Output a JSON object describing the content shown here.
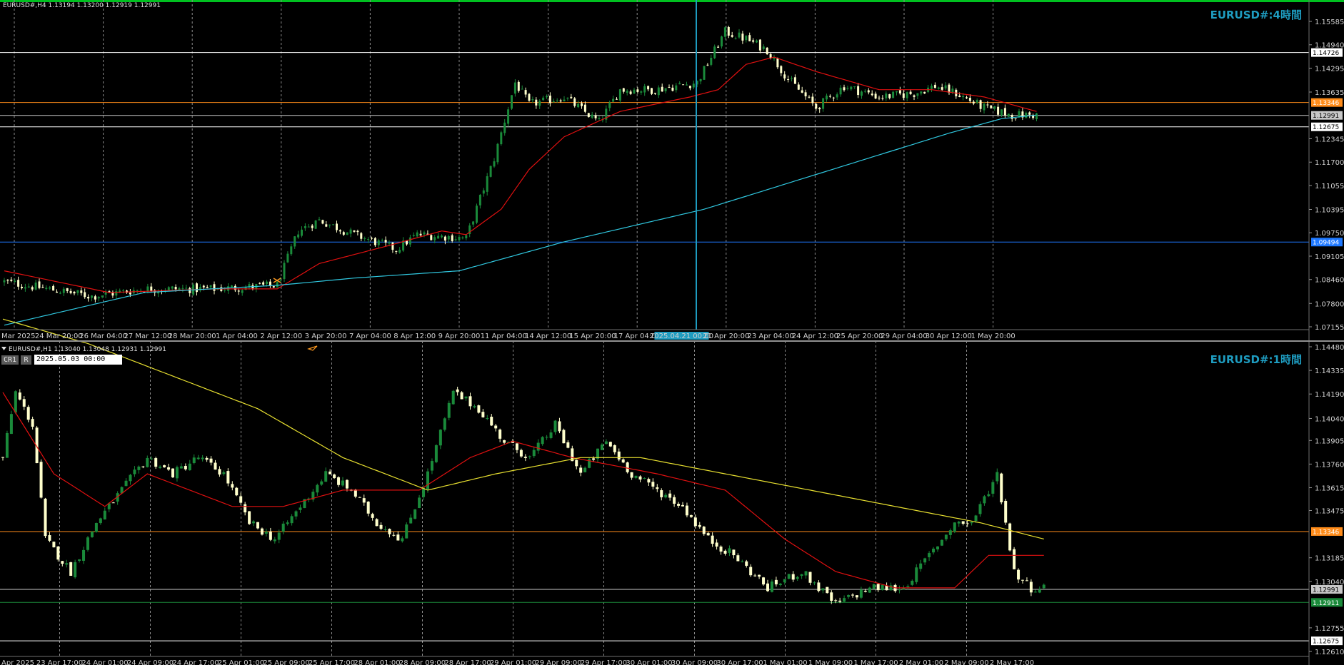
{
  "top_panel": {
    "header": "EURUSD#,H4  1.13194 1.13200 1.12919 1.12991",
    "title": "EURUSD#:4時間",
    "selected_time": "2025.04.21 00:00"
  },
  "bottom_panel": {
    "header": "EURUSD#,H1  1.13040 1.13048 1.12931 1.12991",
    "title": "EURUSD#:1時間",
    "buttons": {
      "cr1": "CR1",
      "r": "R"
    },
    "date_input": "2025.05.03  00:00"
  },
  "colors": {
    "bull": "#1a8a3a",
    "bear": "#ffffcc",
    "ma_fast": "#e01010",
    "ma_slow_top": "#30c8e0",
    "ma_slow_bottom": "#e8e030",
    "accent_top": "#00c020",
    "title": "#1e9cc0"
  },
  "chart_data": [
    {
      "type": "candlestick",
      "title": "EURUSD#:4時間",
      "ylim": [
        1.07155,
        1.15585
      ],
      "y_ticks": [
        "1.15585",
        "1.14940",
        "1.14295",
        "1.13635",
        "1.12345",
        "1.11700",
        "1.11055",
        "1.10395",
        "1.09750",
        "1.09105",
        "1.08460",
        "1.07800",
        "1.07155"
      ],
      "x_ticks": [
        "Mar 2025",
        "24 Mar 20:00",
        "26 Mar 04:00",
        "27 Mar 12:00",
        "28 Mar 20:00",
        "1 Apr 04:00",
        "2 Apr 12:00",
        "3 Apr 20:00",
        "7 Apr 04:00",
        "8 Apr 12:00",
        "9 Apr 20:00",
        "11 Apr 04:00",
        "14 Apr 12:00",
        "15 Apr 20:00",
        "17 Apr 04:00",
        "2025.04.21 00:00",
        "21 Apr 20:00",
        "23 Apr 04:00",
        "24 Apr 12:00",
        "25 Apr 20:00",
        "29 Apr 04:00",
        "30 Apr 12:00",
        "1 May 20:00"
      ],
      "price_lines": [
        {
          "value": 1.14726,
          "label": "1.14726",
          "color": "#ffffff"
        },
        {
          "value": 1.13346,
          "label": "1.13346",
          "color": "#ff8c1a"
        },
        {
          "value": 1.12991,
          "label": "1.12991",
          "color": "#c8c8c8"
        },
        {
          "value": 1.12675,
          "label": "1.12675",
          "color": "#ffffff"
        },
        {
          "value": 1.09494,
          "label": "1.09494",
          "color": "#1e78ff"
        }
      ],
      "close_anchors": [
        [
          0,
          1.084
        ],
        [
          25,
          1.08
        ],
        [
          40,
          1.082
        ],
        [
          60,
          1.082
        ],
        [
          78,
          1.083
        ],
        [
          84,
          1.098
        ],
        [
          90,
          1.101
        ],
        [
          100,
          1.097
        ],
        [
          112,
          1.093
        ],
        [
          118,
          1.097
        ],
        [
          132,
          1.096
        ],
        [
          140,
          1.118
        ],
        [
          146,
          1.139
        ],
        [
          150,
          1.133
        ],
        [
          160,
          1.135
        ],
        [
          170,
          1.128
        ],
        [
          176,
          1.137
        ],
        [
          186,
          1.137
        ],
        [
          198,
          1.139
        ],
        [
          206,
          1.153
        ],
        [
          212,
          1.151
        ],
        [
          218,
          1.148
        ],
        [
          224,
          1.14
        ],
        [
          232,
          1.132
        ],
        [
          240,
          1.138
        ],
        [
          250,
          1.135
        ],
        [
          260,
          1.136
        ],
        [
          266,
          1.138
        ],
        [
          272,
          1.136
        ],
        [
          280,
          1.132
        ],
        [
          288,
          1.13
        ],
        [
          295,
          1.13
        ]
      ],
      "series": [
        {
          "name": "",
          "color": "#e01010",
          "values": [
            [
              0,
              1.087
            ],
            [
              30,
              1.081
            ],
            [
              60,
              1.082
            ],
            [
              78,
              1.082
            ],
            [
              90,
              1.089
            ],
            [
              110,
              1.094
            ],
            [
              125,
              1.098
            ],
            [
              132,
              1.097
            ],
            [
              142,
              1.104
            ],
            [
              150,
              1.115
            ],
            [
              160,
              1.124
            ],
            [
              176,
              1.131
            ],
            [
              196,
              1.135
            ],
            [
              204,
              1.137
            ],
            [
              212,
              1.144
            ],
            [
              220,
              1.146
            ],
            [
              232,
              1.142
            ],
            [
              250,
              1.137
            ],
            [
              265,
              1.137
            ],
            [
              280,
              1.135
            ],
            [
              295,
              1.131
            ]
          ]
        },
        {
          "name": "",
          "color": "#30c8e0",
          "values": [
            [
              0,
              1.072
            ],
            [
              40,
              1.081
            ],
            [
              78,
              1.083
            ],
            [
              100,
              1.085
            ],
            [
              130,
              1.087
            ],
            [
              160,
              1.095
            ],
            [
              200,
              1.104
            ],
            [
              240,
              1.116
            ],
            [
              270,
              1.125
            ],
            [
              285,
              1.129
            ],
            [
              295,
              1.13
            ]
          ]
        }
      ]
    },
    {
      "type": "candlestick",
      "title": "EURUSD#:1時間",
      "ylim": [
        1.1261,
        1.1448
      ],
      "y_ticks": [
        "1.14480",
        "1.14335",
        "1.14190",
        "1.14040",
        "1.13905",
        "1.13760",
        "1.13615",
        "1.13475",
        "1.13185",
        "1.13040",
        "1.12755",
        "1.12610"
      ],
      "x_ticks": [
        "Apr 2025",
        "23 Apr 17:00",
        "24 Apr 01:00",
        "24 Apr 09:00",
        "24 Apr 17:00",
        "25 Apr 01:00",
        "25 Apr 09:00",
        "25 Apr 17:00",
        "28 Apr 01:00",
        "28 Apr 09:00",
        "28 Apr 17:00",
        "29 Apr 01:00",
        "29 Apr 09:00",
        "29 Apr 17:00",
        "30 Apr 01:00",
        "30 Apr 09:00",
        "30 Apr 17:00",
        "1 May 01:00",
        "1 May 09:00",
        "1 May 17:00",
        "2 May 01:00",
        "2 May 09:00",
        "2 May 17:00"
      ],
      "price_lines": [
        {
          "value": 1.13346,
          "label": "1.13346",
          "color": "#ff8c1a"
        },
        {
          "value": 1.12991,
          "label": "1.12991",
          "color": "#c8c8c8"
        },
        {
          "value": 1.12911,
          "label": "1.12911",
          "color": "#1a8a3a"
        },
        {
          "value": 1.12675,
          "label": "1.12675",
          "color": "#ffffff"
        }
      ],
      "close_anchors": [
        [
          0,
          1.138
        ],
        [
          3,
          1.142
        ],
        [
          7,
          1.14
        ],
        [
          10,
          1.133
        ],
        [
          16,
          1.131
        ],
        [
          22,
          1.134
        ],
        [
          28,
          1.136
        ],
        [
          34,
          1.138
        ],
        [
          40,
          1.137
        ],
        [
          46,
          1.138
        ],
        [
          52,
          1.137
        ],
        [
          58,
          1.134
        ],
        [
          64,
          1.133
        ],
        [
          70,
          1.135
        ],
        [
          76,
          1.137
        ],
        [
          82,
          1.136
        ],
        [
          88,
          1.134
        ],
        [
          94,
          1.133
        ],
        [
          100,
          1.137
        ],
        [
          106,
          1.142
        ],
        [
          112,
          1.141
        ],
        [
          118,
          1.139
        ],
        [
          124,
          1.138
        ],
        [
          130,
          1.14
        ],
        [
          136,
          1.137
        ],
        [
          142,
          1.139
        ],
        [
          148,
          1.137
        ],
        [
          154,
          1.136
        ],
        [
          160,
          1.135
        ],
        [
          166,
          1.133
        ],
        [
          172,
          1.132
        ],
        [
          180,
          1.13
        ],
        [
          188,
          1.131
        ],
        [
          196,
          1.129
        ],
        [
          204,
          1.13
        ],
        [
          212,
          1.13
        ],
        [
          218,
          1.132
        ],
        [
          224,
          1.134
        ],
        [
          228,
          1.134
        ],
        [
          234,
          1.137
        ],
        [
          238,
          1.131
        ],
        [
          242,
          1.13
        ],
        [
          245,
          1.13
        ]
      ],
      "series": [
        {
          "name": "",
          "color": "#e01010",
          "values": [
            [
              0,
              1.142
            ],
            [
              12,
              1.137
            ],
            [
              24,
              1.135
            ],
            [
              34,
              1.137
            ],
            [
              44,
              1.136
            ],
            [
              54,
              1.135
            ],
            [
              66,
              1.135
            ],
            [
              80,
              1.136
            ],
            [
              98,
              1.136
            ],
            [
              110,
              1.138
            ],
            [
              120,
              1.139
            ],
            [
              134,
              1.138
            ],
            [
              154,
              1.137
            ],
            [
              170,
              1.136
            ],
            [
              184,
              1.133
            ],
            [
              196,
              1.131
            ],
            [
              210,
              1.13
            ],
            [
              224,
              1.13
            ],
            [
              232,
              1.132
            ],
            [
              238,
              1.132
            ],
            [
              245,
              1.132
            ]
          ]
        },
        {
          "name": "",
          "color": "#e8e030",
          "values": [
            [
              0,
              1.1465
            ],
            [
              20,
              1.145
            ],
            [
              40,
              1.143
            ],
            [
              60,
              1.141
            ],
            [
              80,
              1.138
            ],
            [
              100,
              1.136
            ],
            [
              116,
              1.137
            ],
            [
              136,
              1.138
            ],
            [
              150,
              1.138
            ],
            [
              170,
              1.137
            ],
            [
              190,
              1.136
            ],
            [
              210,
              1.135
            ],
            [
              230,
              1.134
            ],
            [
              245,
              1.133
            ]
          ]
        }
      ]
    }
  ]
}
